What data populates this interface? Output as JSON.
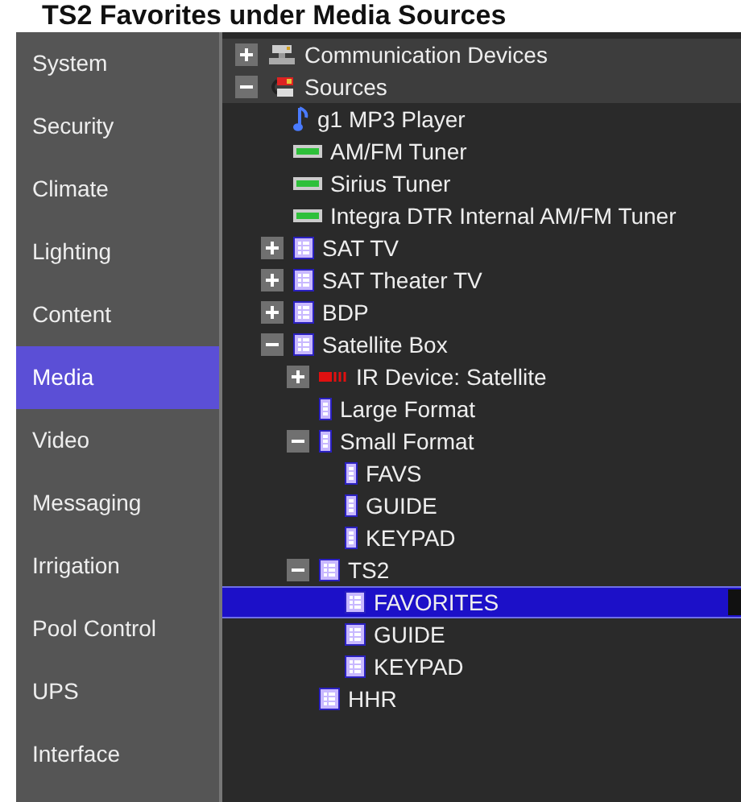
{
  "caption": "TS2 Favorites under Media Sources",
  "sidebar": {
    "items": [
      {
        "label": "System",
        "selected": false
      },
      {
        "label": "Security",
        "selected": false
      },
      {
        "label": "Climate",
        "selected": false
      },
      {
        "label": "Lighting",
        "selected": false
      },
      {
        "label": "Content",
        "selected": false
      },
      {
        "label": "Media",
        "selected": true
      },
      {
        "label": "Video",
        "selected": false
      },
      {
        "label": "Messaging",
        "selected": false
      },
      {
        "label": "Irrigation",
        "selected": false
      },
      {
        "label": "Pool Control",
        "selected": false
      },
      {
        "label": "UPS",
        "selected": false
      },
      {
        "label": "Interface",
        "selected": false
      }
    ]
  },
  "tree": [
    {
      "label": "Communication Devices",
      "kind": "network",
      "expanded": false,
      "selected": false
    },
    {
      "label": "Sources",
      "kind": "sources",
      "expanded": true,
      "selected": false,
      "children": [
        {
          "label": "g1 MP3 Player",
          "kind": "music",
          "selected": false
        },
        {
          "label": "AM/FM Tuner",
          "kind": "tuner",
          "selected": false
        },
        {
          "label": "Sirius Tuner",
          "kind": "tuner",
          "selected": false
        },
        {
          "label": "Integra DTR Internal AM/FM Tuner",
          "kind": "tuner",
          "selected": false
        },
        {
          "label": "SAT TV",
          "kind": "remote",
          "expanded": false,
          "selected": false
        },
        {
          "label": "SAT Theater TV",
          "kind": "remote",
          "expanded": false,
          "selected": false
        },
        {
          "label": "BDP",
          "kind": "remote",
          "expanded": false,
          "selected": false
        },
        {
          "label": "Satellite Box",
          "kind": "remote",
          "expanded": true,
          "selected": false,
          "children": [
            {
              "label": "IR Device: Satellite",
              "kind": "ir",
              "expanded": false,
              "selected": false
            },
            {
              "label": "Large Format",
              "kind": "slim",
              "selected": false
            },
            {
              "label": "Small Format",
              "kind": "slim",
              "expanded": true,
              "selected": false,
              "children": [
                {
                  "label": "FAVS",
                  "kind": "slim",
                  "selected": false
                },
                {
                  "label": "GUIDE",
                  "kind": "slim",
                  "selected": false
                },
                {
                  "label": "KEYPAD",
                  "kind": "slim",
                  "selected": false
                }
              ]
            },
            {
              "label": "TS2",
              "kind": "remote",
              "expanded": true,
              "selected": false,
              "children": [
                {
                  "label": "FAVORITES",
                  "kind": "remote",
                  "selected": true
                },
                {
                  "label": "GUIDE",
                  "kind": "remote",
                  "selected": false
                },
                {
                  "label": "KEYPAD",
                  "kind": "remote",
                  "selected": false
                }
              ]
            },
            {
              "label": "HHR",
              "kind": "remote",
              "selected": false
            }
          ]
        }
      ]
    }
  ]
}
